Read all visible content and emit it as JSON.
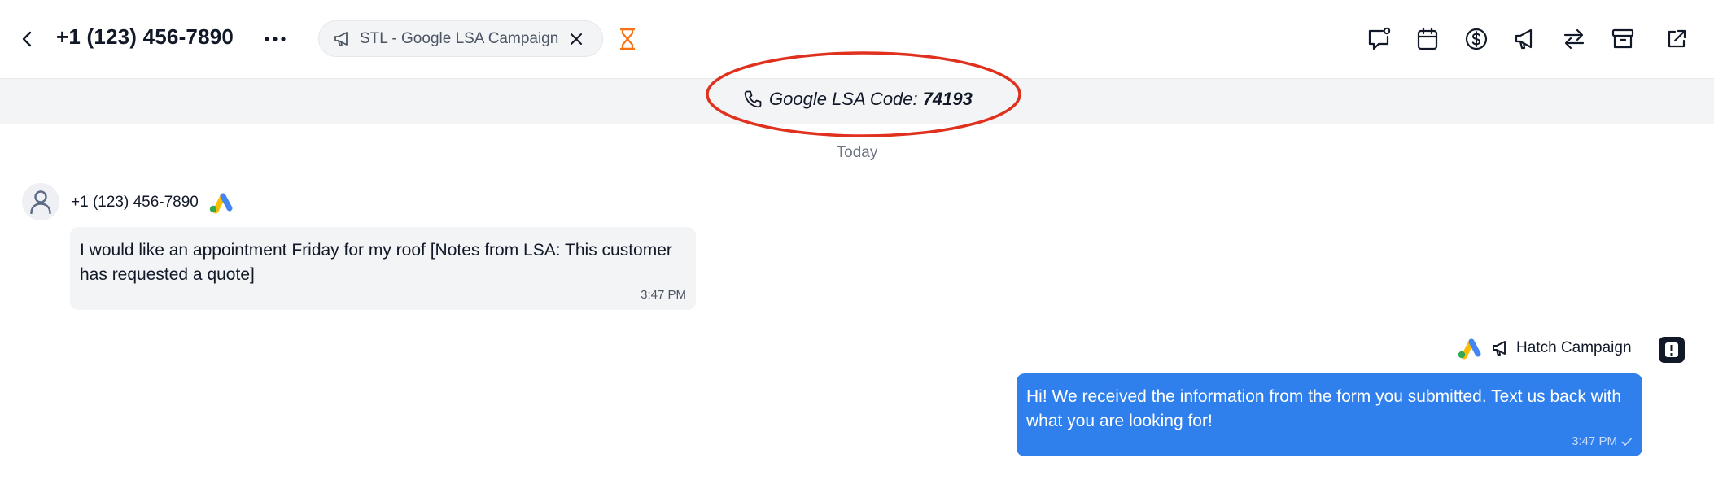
{
  "header": {
    "title": "+1 (123) 456-7890",
    "campaign_chip": {
      "label": "STL - Google LSA Campaign",
      "icon": "megaphone-icon"
    },
    "status_icon": "hourglass-icon",
    "status_color": "#f97316",
    "toolbar": [
      {
        "name": "note-icon"
      },
      {
        "name": "calendar-icon"
      },
      {
        "name": "dollar-icon"
      },
      {
        "name": "megaphone-icon"
      },
      {
        "name": "transfer-icon"
      },
      {
        "name": "archive-icon"
      },
      {
        "name": "external-link-icon"
      }
    ]
  },
  "banner": {
    "label": "Google LSA Code:",
    "code": "74193",
    "annotation_color": "#e0301e"
  },
  "conversation": {
    "day_label": "Today",
    "messages": [
      {
        "direction": "incoming",
        "sender": "+1 (123) 456-7890",
        "text": "I would like an appointment Friday for my roof [Notes from LSA: This customer has requested a quote]",
        "time": "3:47 PM"
      },
      {
        "direction": "outgoing",
        "sender": "Hatch Campaign",
        "text": "Hi! We received the information from the form you submitted. Text us back with what you are looking for!",
        "time": "3:47 PM"
      }
    ]
  },
  "colors": {
    "accent": "#2f80ed",
    "bubble_incoming": "#f3f4f6",
    "banner_bg": "#f3f4f6"
  }
}
